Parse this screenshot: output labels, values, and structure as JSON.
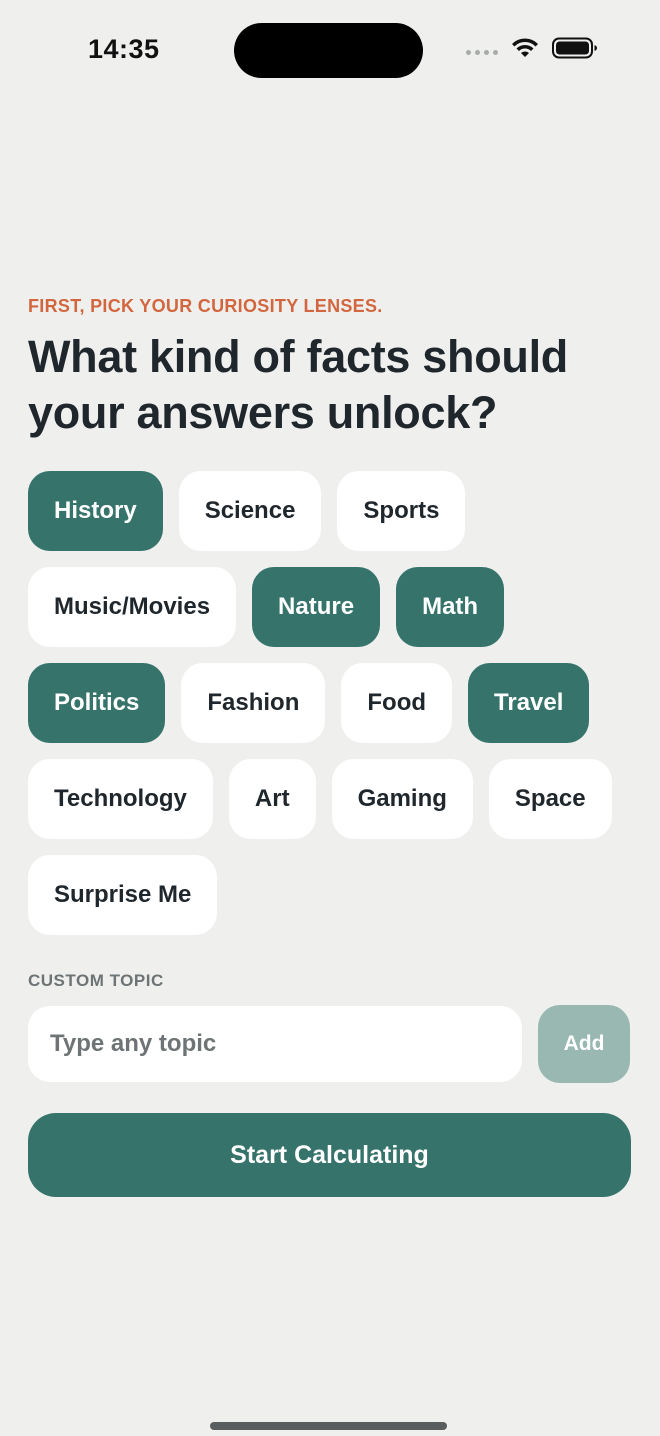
{
  "status_bar": {
    "time": "14:35",
    "signal_icon": "signal-dots-icon",
    "wifi_icon": "wifi-icon",
    "battery_icon": "battery-icon"
  },
  "eyebrow": "FIRST, PICK YOUR CURIOSITY LENSES.",
  "headline": "What kind of facts should your answers unlock?",
  "topics": [
    {
      "label": "History",
      "selected": true
    },
    {
      "label": "Science",
      "selected": false
    },
    {
      "label": "Sports",
      "selected": false
    },
    {
      "label": "Music/Movies",
      "selected": false
    },
    {
      "label": "Nature",
      "selected": true
    },
    {
      "label": "Math",
      "selected": true
    },
    {
      "label": "Politics",
      "selected": true
    },
    {
      "label": "Fashion",
      "selected": false
    },
    {
      "label": "Food",
      "selected": false
    },
    {
      "label": "Travel",
      "selected": true
    },
    {
      "label": "Technology",
      "selected": false
    },
    {
      "label": "Art",
      "selected": false
    },
    {
      "label": "Gaming",
      "selected": false
    },
    {
      "label": "Space",
      "selected": false
    },
    {
      "label": "Surprise Me",
      "selected": false
    }
  ],
  "custom_topic": {
    "label": "CUSTOM TOPIC",
    "placeholder": "Type any topic",
    "value": "",
    "add_label": "Add"
  },
  "start_label": "Start Calculating",
  "colors": {
    "accent": "#36736A",
    "accent_disabled": "#98B8B1",
    "eyebrow": "#D2663F",
    "background": "#EFF0EE"
  }
}
